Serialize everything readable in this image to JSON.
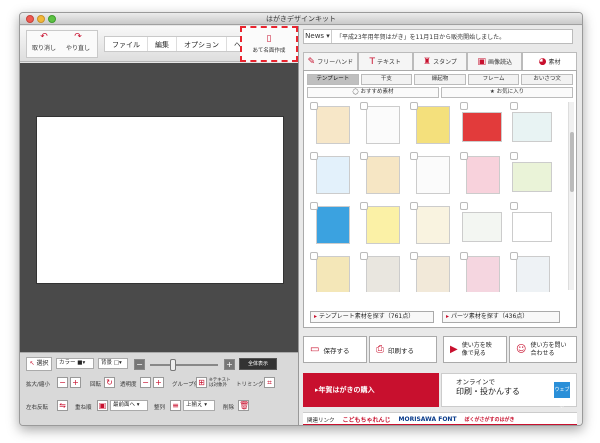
{
  "window": {
    "title": "はがきデザインキット"
  },
  "toolbar": {
    "undo_label": "取り消し",
    "redo_label": "やり直し",
    "menu": [
      "ファイル",
      "編集",
      "オプション",
      "ヘルプ"
    ],
    "address_label": "あて名面作成"
  },
  "news": {
    "label": "News",
    "text": "「平成23年用年賀はがき」を11月1日から販売開始しました。"
  },
  "tabs": [
    {
      "label": "フリーハンド",
      "icon": "pen-icon"
    },
    {
      "label": "テキスト",
      "icon": "text-icon"
    },
    {
      "label": "スタンプ",
      "icon": "stamp-icon"
    },
    {
      "label": "画像読込",
      "icon": "image-icon"
    },
    {
      "label": "素材",
      "icon": "palette-icon"
    }
  ],
  "subtabs": [
    "テンプレート",
    "干支",
    "縁起物",
    "フレーム",
    "おいさつ文"
  ],
  "subtabs2": [
    "おすすめ素材",
    "お気に入り"
  ],
  "find": {
    "templates": "テンプレート素材を探す（761点）",
    "parts": "パーツ素材を探す（436点）"
  },
  "actions": {
    "save": "保存する",
    "print": "印刷する",
    "video": "使い方を映像で見る",
    "contact": "使い方を問い合わせる"
  },
  "banner": {
    "left": "年賀はがきの購入",
    "right_line1": "オンラインで",
    "right_line2": "印刷・投かんする",
    "icon_text": "ウェブポ"
  },
  "links": {
    "label": "関連リンク",
    "items": [
      "こどもちゃれんじ",
      "MORISAWA FONT",
      "ぼくがさがすのはがき"
    ]
  },
  "bottom": {
    "select": "選択",
    "color": "カラー",
    "background": "背景",
    "fit_all": "全体表示",
    "resize": "拡大/縮小",
    "rotate": "回転",
    "opacity": "透明度",
    "group": "グループ化",
    "text_exclude": "※テキストは対象外",
    "trim": "トリミング",
    "flip": "左右反転",
    "order": "重ね順",
    "front": "最前面へ",
    "align": "整列",
    "align_value": "上揃え",
    "delete": "削除"
  },
  "thumbs": [
    "#f7e7c8",
    "#fbfbfb",
    "#f4e07c",
    "#e23b3b",
    "#e8f3f3",
    "#e3f1fb",
    "#f6e6c4",
    "#fbfbfb",
    "#f8d2dc",
    "#eaf3d8",
    "#3ba2e0",
    "#fbf1a6",
    "#f9f3e0",
    "#f3f6f2",
    "#ffffff",
    "#f4e7b8",
    "#e9e6df",
    "#f2e9d9",
    "#f5d6e0",
    "#eef2f5"
  ]
}
